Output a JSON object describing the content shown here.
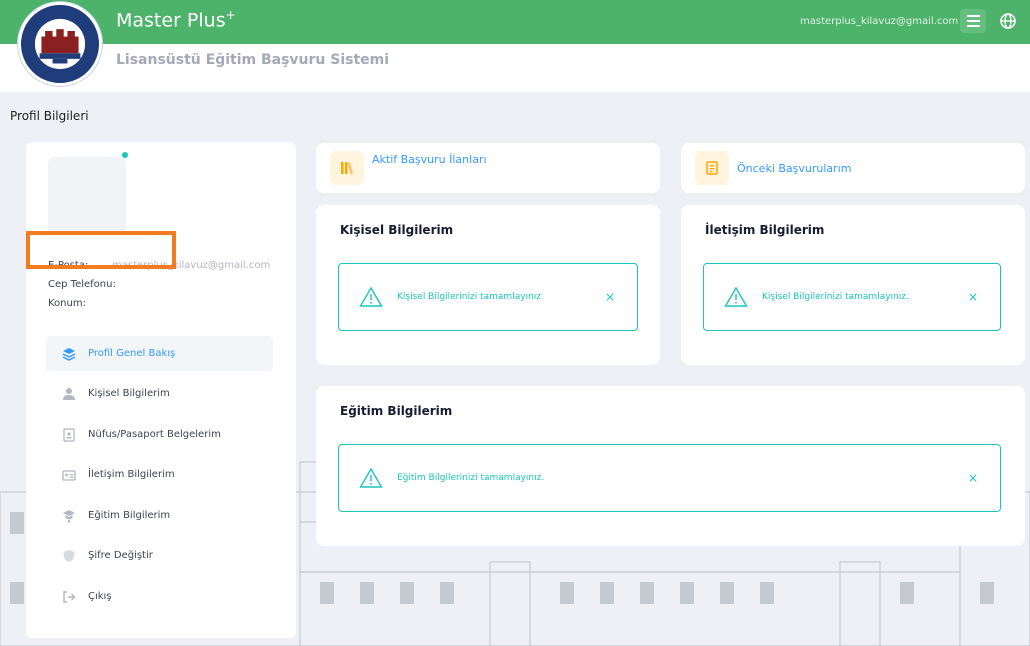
{
  "header": {
    "brand": "Master Plus",
    "brand_sup": "+",
    "system_title": "Lisansüstü Eğitim Başvuru Sistemi",
    "user_email": "masterplus_kilavuz@gmail.com",
    "logo_text": "SAĞLIK BİLİMLERİ ÜNİVERSİTESİ",
    "logo_year": "1903"
  },
  "page": {
    "title": "Profil Bilgileri"
  },
  "profile": {
    "email_label": "E-Posta:",
    "email_value": "masterplus_kilavuz@gmail.com",
    "phone_label": "Cep Telefonu:",
    "location_label": "Konum:"
  },
  "nav": {
    "items": [
      {
        "label": "Profil Genel Bakış",
        "icon": "layers-icon",
        "active": true
      },
      {
        "label": "Kişisel Bilgilerim",
        "icon": "user-icon"
      },
      {
        "label": "Nüfus/Pasaport Belgelerim",
        "icon": "id-card-icon"
      },
      {
        "label": "İletişim Bilgilerim",
        "icon": "contact-card-icon"
      },
      {
        "label": "Eğitim Bilgilerim",
        "icon": "graduation-icon"
      },
      {
        "label": "Şifre Değiştir",
        "icon": "shield-icon"
      },
      {
        "label": "Çıkış",
        "icon": "logout-icon"
      }
    ]
  },
  "quick_links": {
    "active_calls": "Aktif Başvuru İlanları",
    "previous_applications": "Önceki Başvurularım"
  },
  "cards": {
    "personal": {
      "title": "Kişisel Bilgilerim",
      "alert": "Kişisel Bilgilerinizi tamamlayınız",
      "close": "×"
    },
    "contact": {
      "title": "İletişim Bilgilerim",
      "alert": "Kişisel Bilgilerinizi tamamlayınız.",
      "close": "×"
    },
    "education": {
      "title": "Eğitim Bilgilerim",
      "alert": "Eğitim Bilgilerinizi tamamlayınız.",
      "close": "×"
    }
  },
  "colors": {
    "header_green": "#4db26a",
    "alert_teal": "#1bc5bd",
    "link_blue": "#3699ff",
    "highlight_orange": "#f47c20"
  }
}
